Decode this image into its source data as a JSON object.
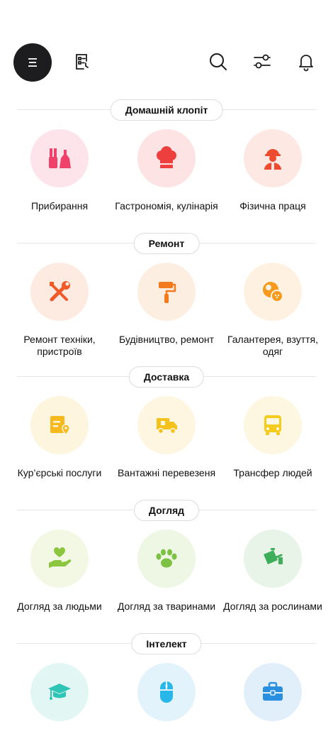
{
  "header": {
    "menu_icon": "menu-icon",
    "list_icon": "clipboard-list-icon",
    "search_icon": "search-icon",
    "filter_icon": "filter-sliders-icon",
    "bell_icon": "bell-icon"
  },
  "sections": [
    {
      "title": "Домашній клопіт",
      "items": [
        {
          "label": "Прибирання",
          "icon": "cleaning-icon",
          "bg": "#fde3ea",
          "fg": "#f0416b"
        },
        {
          "label": "Гастрономія, кулінарія",
          "icon": "chef-hat-icon",
          "bg": "#fde3e3",
          "fg": "#ee3f3f"
        },
        {
          "label": "Фізична праця",
          "icon": "worker-icon",
          "bg": "#fde8e4",
          "fg": "#ee4a2f"
        }
      ]
    },
    {
      "title": "Ремонт",
      "items": [
        {
          "label": "Ремонт техніки, пристроїв",
          "icon": "tools-icon",
          "bg": "#fdebe2",
          "fg": "#f05a28"
        },
        {
          "label": "Будівництво, ремонт",
          "icon": "paint-roller-icon",
          "bg": "#fdeee2",
          "fg": "#f47a1f"
        },
        {
          "label": "Галантерея, взуття, одяг",
          "icon": "buttons-icon",
          "bg": "#fef1e1",
          "fg": "#f59a1d"
        }
      ]
    },
    {
      "title": "Доставка",
      "items": [
        {
          "label": "Кур’єрські послуги",
          "icon": "courier-box-icon",
          "bg": "#fef5df",
          "fg": "#f6b91e"
        },
        {
          "label": "Вантажні перевезеня",
          "icon": "truck-icon",
          "bg": "#fef6e0",
          "fg": "#f5c21c"
        },
        {
          "label": "Трансфер людей",
          "icon": "bus-icon",
          "bg": "#fdf7e2",
          "fg": "#f3cc1e"
        }
      ]
    },
    {
      "title": "Догляд",
      "items": [
        {
          "label": "Догляд за людьми",
          "icon": "care-hand-icon",
          "bg": "#f3f8e4",
          "fg": "#8cc63f"
        },
        {
          "label": "Догляд за тваринами",
          "icon": "paw-icon",
          "bg": "#eef6e4",
          "fg": "#7cc143"
        },
        {
          "label": "Догляд за рослинами",
          "icon": "watering-can-icon",
          "bg": "#e8f4e8",
          "fg": "#3fae5a"
        }
      ]
    },
    {
      "title": "Інтелект",
      "items": [
        {
          "label": "",
          "icon": "graduation-cap-icon",
          "bg": "#e2f7f4",
          "fg": "#2ec4b6"
        },
        {
          "label": "",
          "icon": "computer-mouse-icon",
          "bg": "#e2f3fb",
          "fg": "#29b6e8"
        },
        {
          "label": "",
          "icon": "briefcase-icon",
          "bg": "#e1effb",
          "fg": "#2b8fe0"
        }
      ]
    }
  ]
}
